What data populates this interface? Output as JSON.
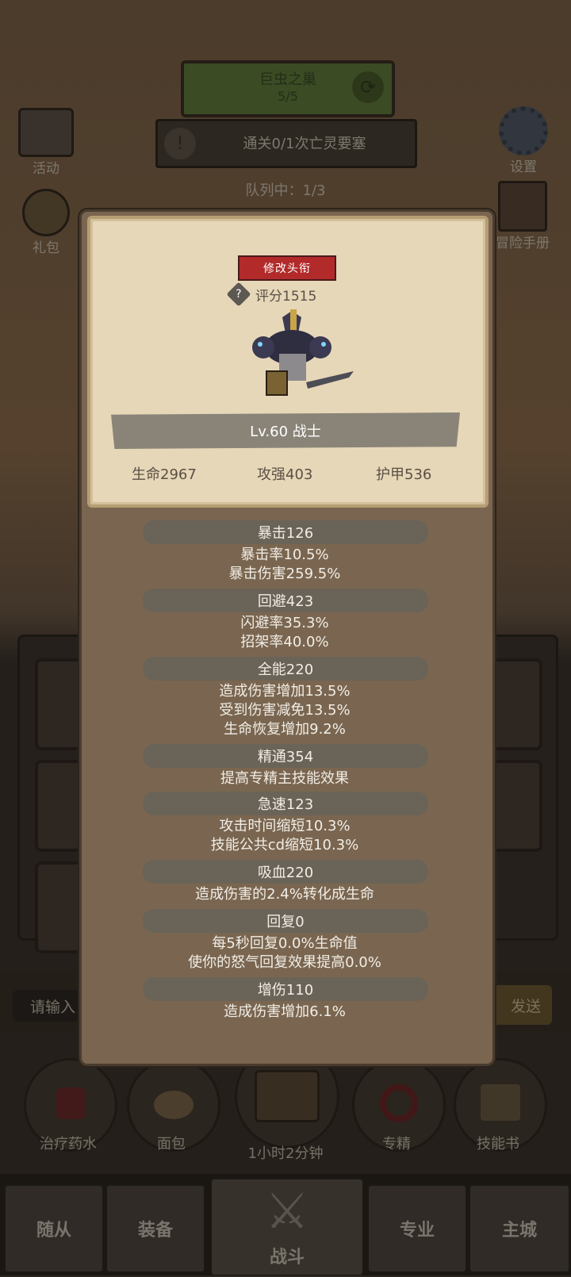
{
  "hud": {
    "zone_name": "巨虫之巢",
    "zone_progress": "5/5",
    "quest_text": "通关0/1次亡灵要塞",
    "queue_text": "队列中：1/3",
    "left_top_label": "活动",
    "left_mid_label": "礼包",
    "right_top_label": "设置",
    "right_mid_label": "冒险手册"
  },
  "chat": {
    "input_placeholder": "请输入",
    "send_label": "发送"
  },
  "consumables": [
    {
      "label": "治疗药水"
    },
    {
      "label": "面包"
    },
    {
      "label": "1小时2分钟"
    },
    {
      "label": "专精"
    },
    {
      "label": "技能书"
    }
  ],
  "tabs": [
    {
      "label": "随从"
    },
    {
      "label": "装备"
    },
    {
      "label": "战斗"
    },
    {
      "label": "专业"
    },
    {
      "label": "主城"
    }
  ],
  "popup": {
    "title_button": "修改头衔",
    "score": "评分1515",
    "level_class": "Lv.60 战士",
    "hp": "生命2967",
    "attack": "攻强403",
    "armor": "护甲536",
    "stats": [
      {
        "head": "暴击126",
        "lines": [
          "暴击率10.5%",
          "暴击伤害259.5%"
        ]
      },
      {
        "head": "回避423",
        "lines": [
          "闪避率35.3%",
          "招架率40.0%"
        ]
      },
      {
        "head": "全能220",
        "lines": [
          "造成伤害增加13.5%",
          "受到伤害减免13.5%",
          "生命恢复增加9.2%"
        ]
      },
      {
        "head": "精通354",
        "lines": [
          "提高专精主技能效果"
        ]
      },
      {
        "head": "急速123",
        "lines": [
          "攻击时间缩短10.3%",
          "技能公共cd缩短10.3%"
        ]
      },
      {
        "head": "吸血220",
        "lines": [
          "造成伤害的2.4%转化成生命"
        ]
      },
      {
        "head": "回复0",
        "lines": [
          "每5秒回复0.0%生命值",
          "使你的怒气回复效果提高0.0%"
        ]
      },
      {
        "head": "增伤110",
        "lines": [
          "造成伤害增加6.1%"
        ]
      }
    ]
  },
  "colors": {
    "title_button": "#b22a2a",
    "parchment": "#e6d7b8",
    "panel": "#7a6650",
    "zone_bar": "#7fa24a"
  }
}
